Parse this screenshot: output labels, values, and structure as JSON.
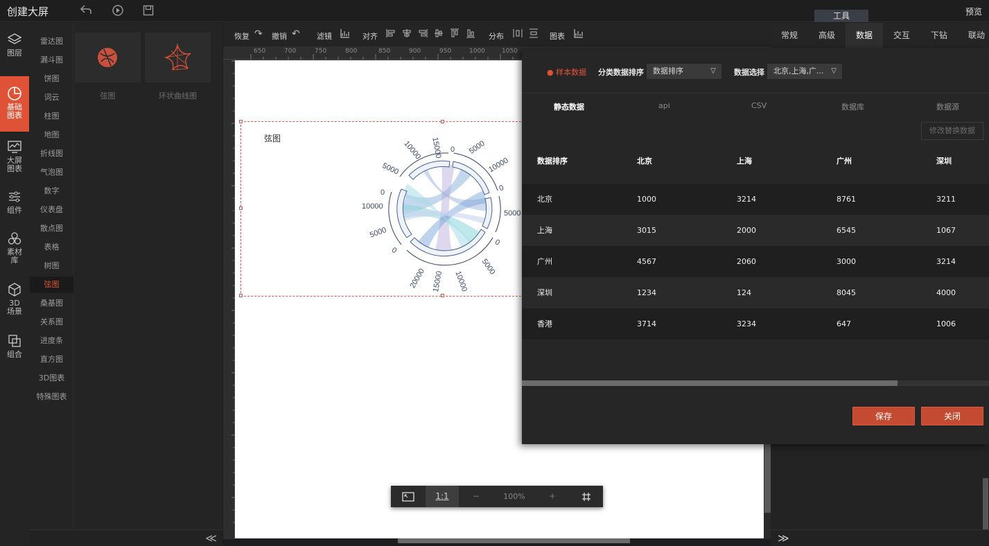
{
  "app": {
    "title": "创建大屏",
    "preview": "预览",
    "tools_tab": "工具"
  },
  "left_rail": [
    {
      "label": "图层",
      "icon": "layers-icon"
    },
    {
      "label": "基础\n图表",
      "icon": "pie-chart-icon",
      "active": true
    },
    {
      "label": "大屏\n图表",
      "icon": "monitor-chart-icon"
    },
    {
      "label": "组件",
      "icon": "sliders-icon"
    },
    {
      "label": "素材\n库",
      "icon": "material-icon"
    },
    {
      "label": "3D\n场景",
      "icon": "cube-icon"
    },
    {
      "label": "组合",
      "icon": "group-icon"
    }
  ],
  "categories": [
    "雷达图",
    "漏斗图",
    "饼图",
    "词云",
    "柱图",
    "地图",
    "折线图",
    "气泡图",
    "数字",
    "仪表盘",
    "散点图",
    "表格",
    "树图",
    "弦图",
    "桑基图",
    "关系图",
    "进度条",
    "直方图",
    "3D图表",
    "特殊图表"
  ],
  "active_category": "弦图",
  "thumbnails": [
    {
      "label": "弦图"
    },
    {
      "label": "环状曲线图"
    }
  ],
  "toolbar": {
    "redo": "恢复",
    "undo": "撤销",
    "filter": "滤镜",
    "align": "对齐",
    "distribute": "分布",
    "chart": "图表"
  },
  "ruler": {
    "ticks": [
      "650",
      "700",
      "750",
      "800",
      "850",
      "900",
      "950",
      "1000",
      "1050"
    ]
  },
  "canvas": {
    "chart_title": "弦图"
  },
  "zoom": {
    "ratio": "1:1",
    "minus": "−",
    "level": "100%",
    "plus": "+"
  },
  "right_tabs": [
    "常规",
    "高级",
    "数据",
    "交互",
    "下钻",
    "联动"
  ],
  "active_right_tab": "数据",
  "data_panel": {
    "sample_label": "样本数据",
    "sort_label": "分类数据排序",
    "sort_value": "数据排序",
    "select_label": "数据选择",
    "select_value": "北京,上海,广...",
    "source_tabs": [
      "静态数据",
      "api",
      "CSV",
      "数据库",
      "数据源"
    ],
    "replace_button": "修改替换数据",
    "table": {
      "headers": [
        "数据排序",
        "北京",
        "上海",
        "广州",
        "深圳"
      ],
      "rows": [
        [
          "北京",
          "1000",
          "3214",
          "8761",
          "3211"
        ],
        [
          "上海",
          "3015",
          "2000",
          "6545",
          "1067"
        ],
        [
          "广州",
          "4567",
          "2060",
          "3000",
          "3214"
        ],
        [
          "深圳",
          "1234",
          "124",
          "8045",
          "4000"
        ],
        [
          "香港",
          "3714",
          "3234",
          "647",
          "1006"
        ]
      ]
    },
    "save": "保存",
    "close": "关闭"
  },
  "chord_ticks": [
    "15000",
    "10000",
    "5000",
    "0",
    "5000",
    "10000",
    "0",
    "5000",
    "0",
    "5000",
    "20000",
    "15000",
    "10000",
    "0",
    "5000",
    "10000",
    "0",
    "5000",
    "0"
  ],
  "colors": {
    "accent": "#e05236",
    "panel": "#262626"
  }
}
